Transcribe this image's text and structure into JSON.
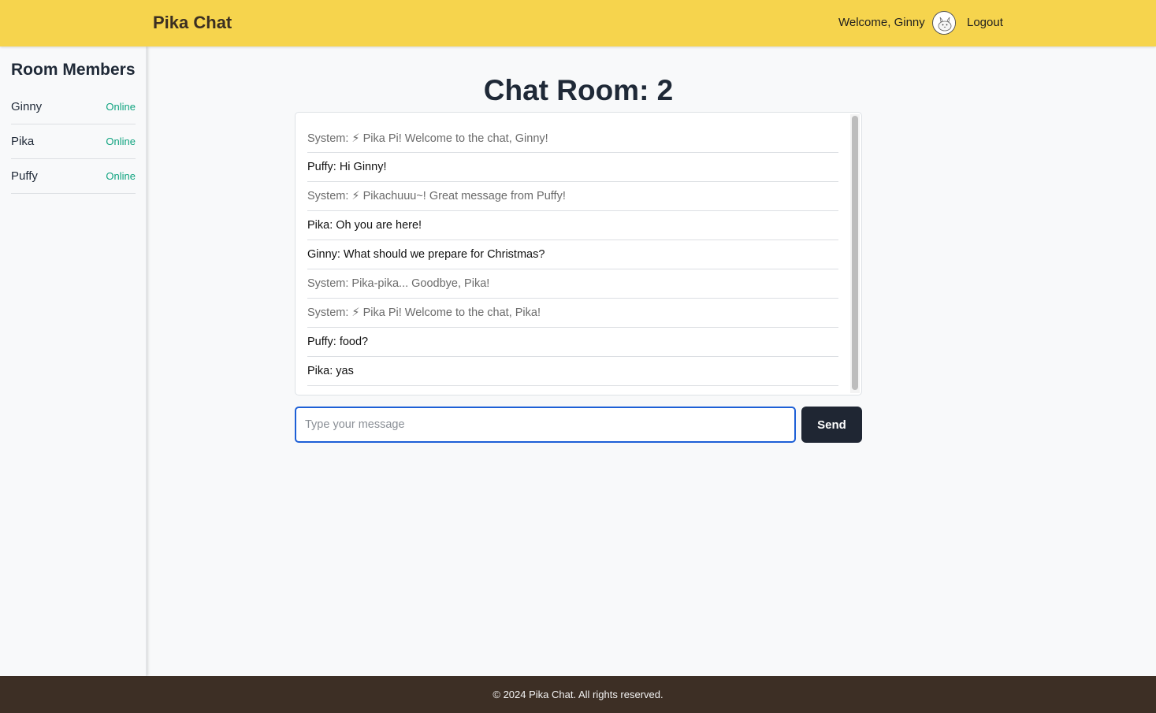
{
  "header": {
    "brand": "Pika Chat",
    "welcome": "Welcome, Ginny",
    "logout": "Logout",
    "avatar_icon": "pokemon-avatar-icon"
  },
  "sidebar": {
    "title": "Room Members",
    "members": [
      {
        "name": "Ginny",
        "status": "Online"
      },
      {
        "name": "Pika",
        "status": "Online"
      },
      {
        "name": "Puffy",
        "status": "Online"
      }
    ]
  },
  "main": {
    "room_title": "Chat Room: 2",
    "messages": [
      {
        "text": "System: ⚡ Pika Pi! Welcome to the chat, Ginny!",
        "type": "system"
      },
      {
        "text": "Puffy: Hi Ginny!",
        "type": "user"
      },
      {
        "text": "System: ⚡ Pikachuuu~! Great message from Puffy!",
        "type": "system"
      },
      {
        "text": "Pika: Oh you are here!",
        "type": "user"
      },
      {
        "text": "Ginny: What should we prepare for Christmas?",
        "type": "user"
      },
      {
        "text": "System: Pika-pika... Goodbye, Pika!",
        "type": "system"
      },
      {
        "text": "System: ⚡ Pika Pi! Welcome to the chat, Pika!",
        "type": "system"
      },
      {
        "text": "Puffy: food?",
        "type": "user"
      },
      {
        "text": "Pika: yas",
        "type": "user"
      }
    ],
    "input": {
      "placeholder": "Type your message",
      "value": ""
    },
    "send_label": "Send"
  },
  "footer": {
    "text": "© 2024 Pika Chat. All rights reserved."
  },
  "colors": {
    "header_bg": "#f6d44d",
    "footer_bg": "#3d2f25",
    "online": "#10a37f",
    "send_bg": "#1f2633",
    "input_focus": "#1d5fd6"
  }
}
